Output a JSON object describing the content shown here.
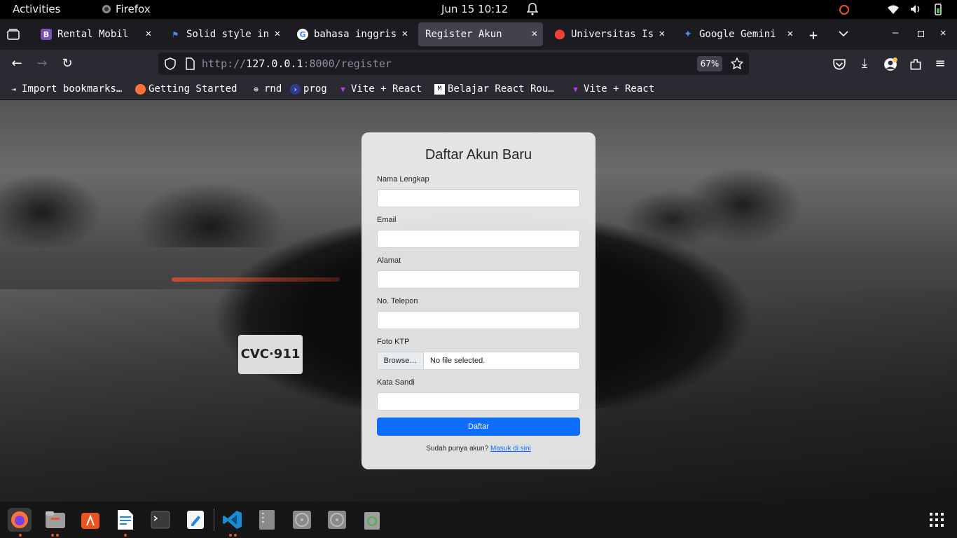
{
  "topbar": {
    "activities": "Activities",
    "app_name": "Firefox",
    "clock": "Jun 15  10:12"
  },
  "tabs": [
    {
      "label": "Rental Mobil",
      "icon": "bootstrap-icon",
      "color": "#7952b3",
      "active": false
    },
    {
      "label": "Solid style in",
      "icon": "flag-icon",
      "color": "#1f6feb",
      "active": false
    },
    {
      "label": "bahasa inggris",
      "icon": "google-icon",
      "color": "#ffffff",
      "active": false
    },
    {
      "label": "Register Akun",
      "icon": "",
      "color": "",
      "active": true
    },
    {
      "label": "Universitas Is",
      "icon": "maps-pin-icon",
      "color": "#34a853",
      "active": false
    },
    {
      "label": "Google Gemini",
      "icon": "gemini-icon",
      "color": "#4f8df5",
      "active": false
    }
  ],
  "navbar": {
    "url_scheme": "http://",
    "url_host": "127.0.0.1",
    "url_rest": ":8000/register",
    "zoom": "67%"
  },
  "bookmarks": [
    {
      "label": "Import bookmarks…",
      "icon": "import-icon"
    },
    {
      "label": "Getting Started",
      "icon": "firefox-icon"
    },
    {
      "label": "rnd",
      "icon": "globe-icon"
    },
    {
      "label": "prog",
      "icon": "arrow-circle-icon"
    },
    {
      "label": "Vite + React",
      "icon": "vite-icon"
    },
    {
      "label": "Belajar React Rou…",
      "icon": "medium-icon"
    },
    {
      "label": "Vite + React",
      "icon": "vite-icon"
    }
  ],
  "form": {
    "title": "Daftar Akun Baru",
    "name_label": "Nama Lengkap",
    "email_label": "Email",
    "address_label": "Alamat",
    "phone_label": "No. Telepon",
    "ktp_label": "Foto KTP",
    "browse_label": "Browse…",
    "no_file": "No file selected.",
    "password_label": "Kata Sandi",
    "submit_label": "Daftar",
    "login_prompt": "Sudah punya akun?",
    "login_link": "Masuk di sini",
    "plate_text": "CVC·911"
  },
  "colors": {
    "primary": "#0d6efd",
    "ubuntu_orange": "#e95420"
  }
}
